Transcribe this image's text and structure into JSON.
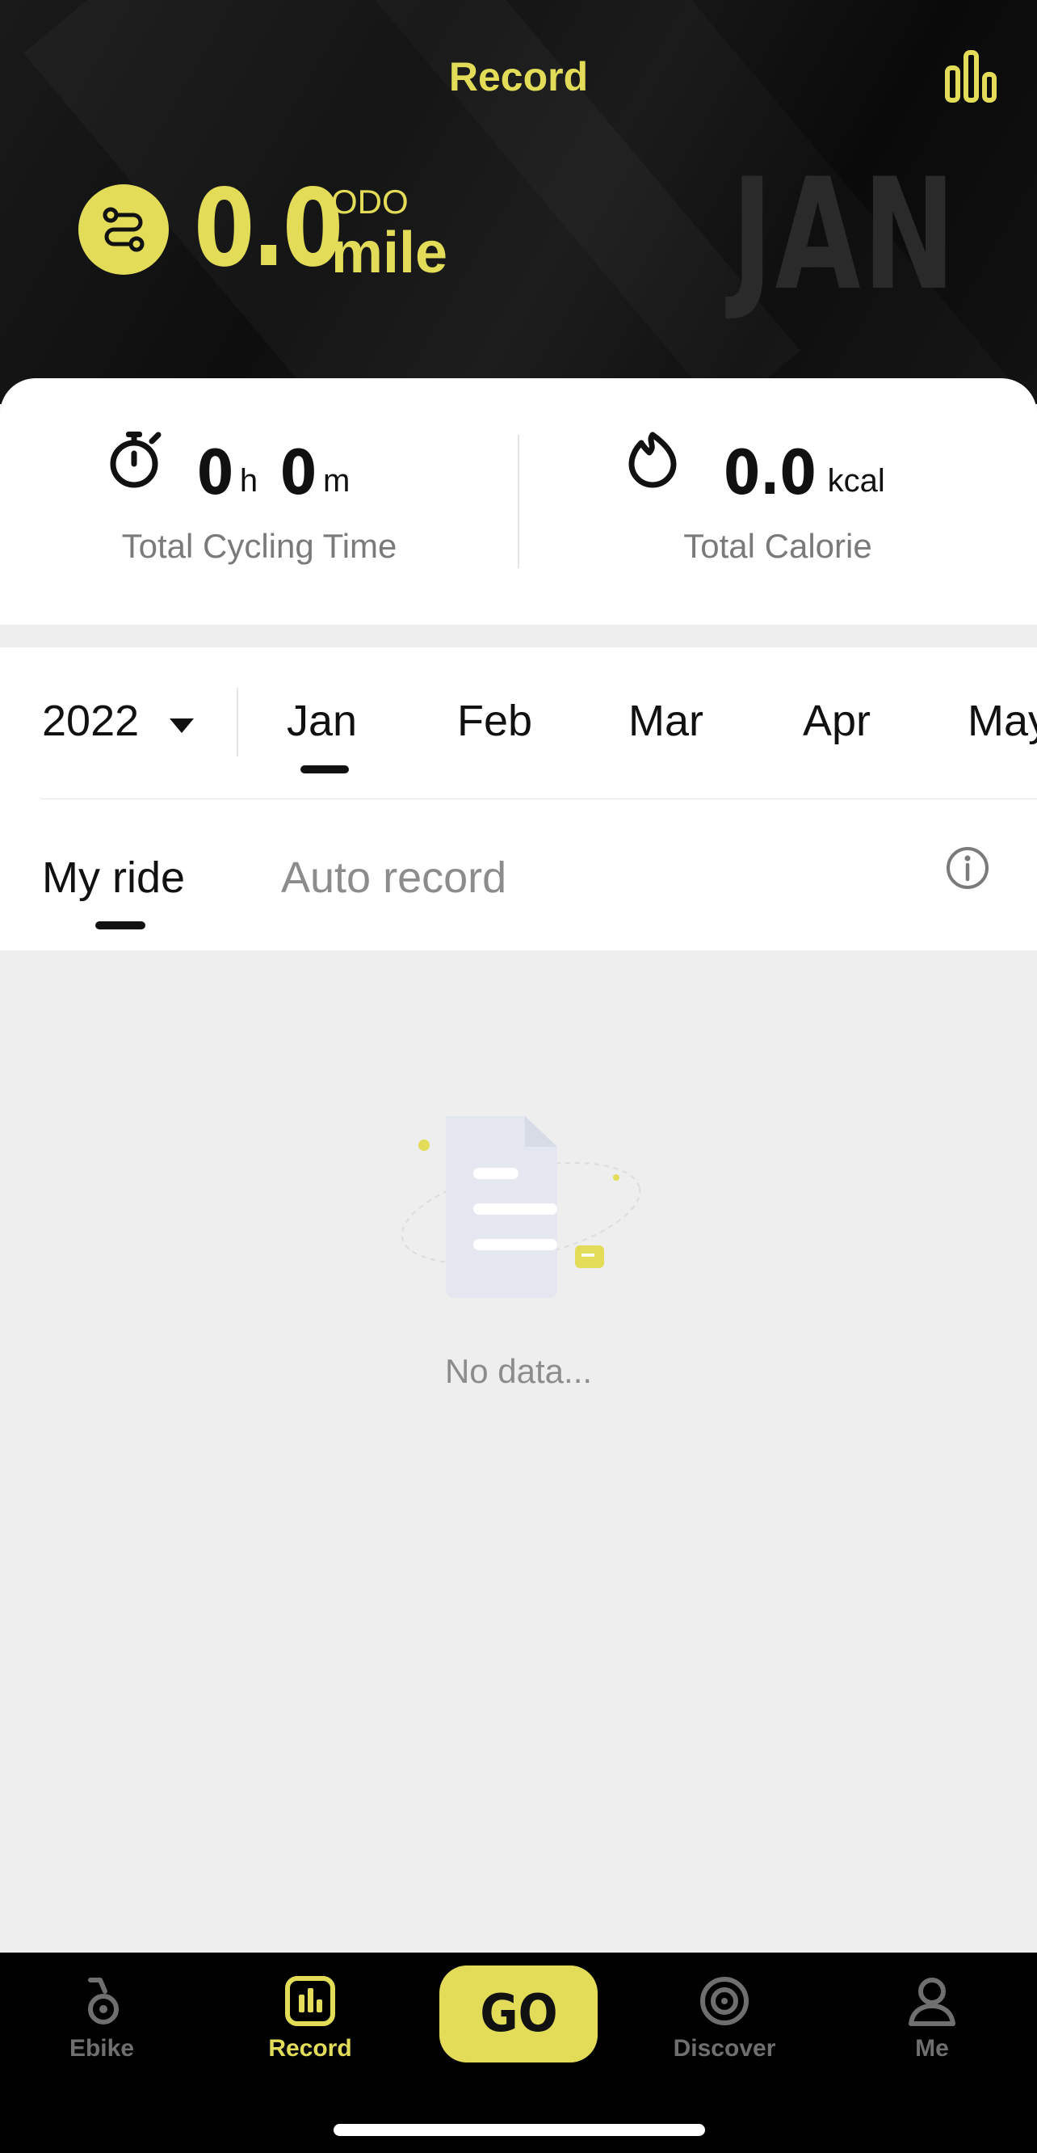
{
  "header": {
    "title": "Record",
    "odo_label": "ODO",
    "odo_value": "0.0",
    "odo_unit": "mile",
    "month_watermark": "JAN"
  },
  "summary": {
    "time_hours": "0",
    "time_hours_unit": "h",
    "time_minutes": "0",
    "time_minutes_unit": "m",
    "time_caption": "Total Cycling Time",
    "calorie_value": "0.0",
    "calorie_unit": "kcal",
    "calorie_caption": "Total Calorie"
  },
  "selector": {
    "year": "2022",
    "months": [
      "Jan",
      "Feb",
      "Mar",
      "Apr",
      "May"
    ],
    "selected_month": "Jan"
  },
  "tabs": {
    "my_ride": "My ride",
    "auto_record": "Auto record",
    "active": "My ride"
  },
  "empty_state": {
    "text": "No data..."
  },
  "nav": {
    "ebike": "Ebike",
    "record": "Record",
    "go": "GO",
    "discover": "Discover",
    "me": "Me",
    "active": "Record"
  },
  "colors": {
    "accent": "#e2dc58",
    "header_bg": "#111111",
    "nav_bg": "#000000",
    "page_bg": "#eeeeee",
    "inactive_text": "#8c8c8c"
  },
  "icons": {
    "stats": "bar-chart-icon",
    "odo": "route-icon",
    "timer": "stopwatch-icon",
    "calorie": "flame-icon",
    "info": "info-icon",
    "empty": "empty-document-illustration",
    "ebike": "bike-icon",
    "record": "record-chart-icon",
    "discover": "discover-icon",
    "me": "person-icon"
  }
}
